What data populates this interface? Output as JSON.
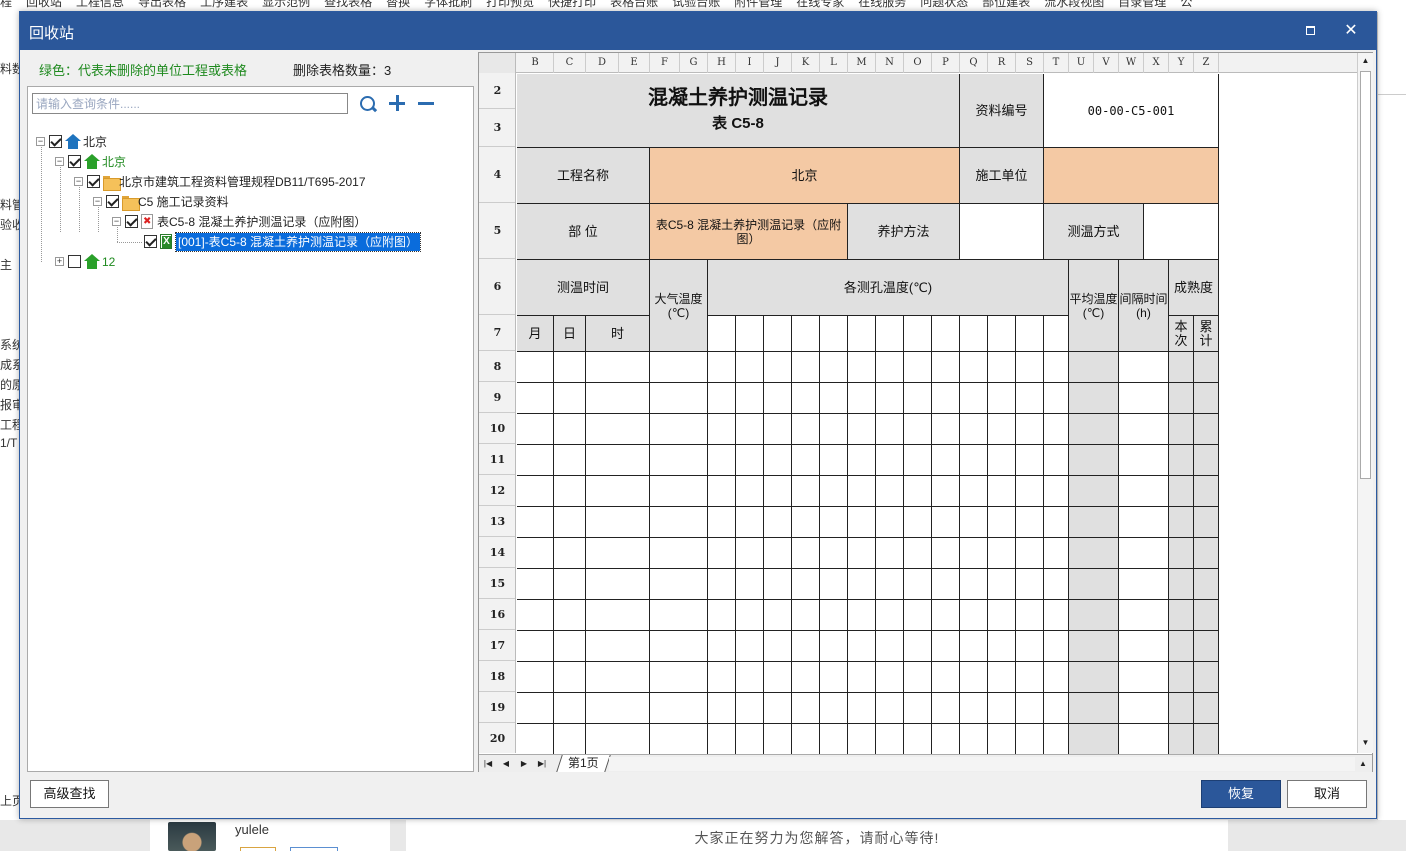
{
  "background": {
    "menu_items": [
      "程",
      "回收站",
      "工程信息",
      "导出表格",
      "工序建表",
      "显示范例",
      "查找表格",
      "替换",
      "字体批刷",
      "打印预览",
      "快捷打印",
      "表格台账",
      "试验台账",
      "附件管理",
      "在线专家",
      "在线服务",
      "问题状态",
      "部位建表",
      "流水段视图",
      "目录管理",
      "公"
    ],
    "left_fragments": [
      {
        "text": "料数"
      },
      {
        "text": "料管"
      },
      {
        "text": "验收"
      },
      {
        "text": "主"
      },
      {
        "text": "系统"
      },
      {
        "text": "成系"
      },
      {
        "text": "的原"
      },
      {
        "text": "报审"
      },
      {
        "text": "工程"
      },
      {
        "text": "1/T"
      },
      {
        "text": "上页"
      }
    ],
    "username": "yulele",
    "message": "大家正在努力为您解答，请耐心等待!"
  },
  "dialog": {
    "title": "回收站",
    "legend": "绿色：代表未删除的单位工程或表格",
    "delete_count_label": "删除表格数量：3",
    "search_placeholder": "请输入查询条件......",
    "buttons": {
      "advanced": "高级查找",
      "restore": "恢复",
      "cancel": "取消"
    }
  },
  "tree": [
    {
      "label": "北京",
      "icon": "home-blue-icon",
      "expander": "⊟",
      "checked": true
    },
    {
      "label": "北京",
      "icon": "home-green-icon",
      "expander": "⊟",
      "checked": true,
      "green": true
    },
    {
      "label": "北京市建筑工程资料管理规程DB11/T695-2017",
      "icon": "folder-icon",
      "expander": "⊟",
      "checked": true
    },
    {
      "label": "C5 施工记录资料",
      "icon": "folder-icon",
      "expander": "⊟",
      "checked": true
    },
    {
      "label": "表C5-8 混凝土养护测温记录（应附图）",
      "icon": "deleted-file-icon",
      "expander": "⊟",
      "checked": true
    },
    {
      "label": "[001]-表C5-8 混凝土养护测温记录（应附图）",
      "icon": "excel-file-icon",
      "checked": true,
      "selected": true
    },
    {
      "label": "12",
      "icon": "home-green-icon",
      "expander": "⊞",
      "checked": false,
      "green": true
    }
  ],
  "sheet": {
    "columns": [
      "B",
      "C",
      "D",
      "E",
      "F",
      "G",
      "H",
      "I",
      "J",
      "K",
      "L",
      "M",
      "N",
      "O",
      "P",
      "Q",
      "R",
      "S",
      "T",
      "U",
      "V",
      "W",
      "X",
      "Y",
      "Z"
    ],
    "rows": [
      "2",
      "3",
      "4",
      "5",
      "6",
      "7",
      "8",
      "9",
      "10",
      "11",
      "12",
      "13",
      "14",
      "15",
      "16",
      "17",
      "18",
      "19",
      "20"
    ],
    "title": "混凝土养护测温记录",
    "subtitle": "表 C5-8",
    "doc_no_label": "资料编号",
    "doc_no": "00-00-C5-001",
    "project_label": "工程名称",
    "project_value": "北京",
    "builder_label": "施工单位",
    "part_label": "部 位",
    "part_value": "表C5-8 混凝土养护测温记录（应附图）",
    "curing_label": "养护方法",
    "measure_label": "测温方式",
    "time_label": "测温时间",
    "air_temp_label": "大气温度(℃)",
    "holes_label": "各测孔温度(℃)",
    "avg_label": "平均温度(℃)",
    "interval_label": "间隔时间(h)",
    "maturity_label": "成熟度",
    "month": "月",
    "day": "日",
    "hour": "时",
    "current": "本次",
    "total": "累计",
    "tab": "第1页"
  }
}
